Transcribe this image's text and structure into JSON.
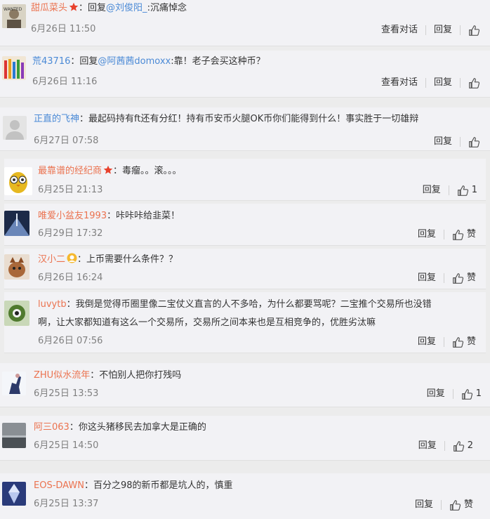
{
  "comments": [
    {
      "user": "甜瓜菜头",
      "sep": "：",
      "reply_prefix": "回复",
      "mention": "@刘俊阳_",
      "text": ":沉痛悼念",
      "time": "6月26日 11:50",
      "view_dialog": "查看对话",
      "reply": "回复",
      "like_count": ""
    },
    {
      "user": "荒43716",
      "sep": "：",
      "reply_prefix": "回复",
      "mention": "@阿茜茜domoxx",
      "text": ":靠！老子会买这种币？",
      "time": "6月26日 11:16",
      "view_dialog": "查看对话",
      "reply": "回复",
      "like_count": ""
    },
    {
      "user": "正直的飞神",
      "sep": "：",
      "text": "最起码持有ft还有分红！持有币安币火腿OK币你们能得到什么！事实胜于一切雄辩",
      "time": "6月27日 07:58",
      "reply": "回复",
      "like_count": ""
    },
    {
      "user": "最靠谱的经纪商",
      "sep": "：",
      "text": "毒瘤。。滚。。。",
      "time": "6月25日 21:13",
      "reply": "回复",
      "like_count": "1"
    },
    {
      "user": "唯爱小盆友1993",
      "sep": "：",
      "text": "咔咔咔给韭菜！",
      "time": "6月29日 17:32",
      "reply": "回复",
      "like_label": "赞"
    },
    {
      "user": "汉小二",
      "sep": "：",
      "text": "上币需要什么条件？？",
      "time": "6月26日 16:24",
      "reply": "回复",
      "like_label": "赞"
    },
    {
      "user": "luvytb",
      "sep": "：",
      "text": "我倒是觉得币圈里像二宝仗义直言的人不多哈，为什么都要骂呢？二宝推个交易所也没错",
      "text2": "啊，让大家都知道有这么一个交易所，交易所之间本来也是互相竞争的，优胜劣汰嘛",
      "time": "6月26日 07:56",
      "reply": "回复",
      "like_label": "赞"
    },
    {
      "user": "ZHU似水流年",
      "sep": "：",
      "text": "不怕别人把你打残吗",
      "time": "6月25日 13:53",
      "reply": "回复",
      "like_count": "1"
    },
    {
      "user": "阿三063",
      "sep": "：",
      "text": "你这头猪移民去加拿大是正确的",
      "time": "6月25日 14:50",
      "reply": "回复",
      "like_count": "2"
    },
    {
      "user": "EOS-DAWN",
      "sep": "：",
      "text": "百分之98的新币都是坑人的，慎重",
      "time": "6月25日 13:37",
      "reply": "回复",
      "like_label": "赞"
    }
  ],
  "icons": {
    "like": "thumbs-up-icon",
    "badge_star": "red-star-badge-icon",
    "badge_member": "gold-member-badge-icon"
  },
  "colors": {
    "username": "#eb7350",
    "link": "#4b8ad6",
    "background": "#f2f2f5"
  }
}
